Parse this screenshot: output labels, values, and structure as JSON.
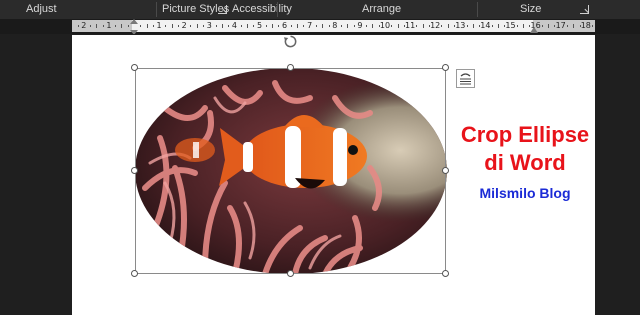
{
  "ribbon": {
    "groups": [
      {
        "label": "Adjust"
      },
      {
        "label": "Picture Styles"
      },
      {
        "label": "Accessibility"
      },
      {
        "label": "Arrange"
      },
      {
        "label": "Size"
      }
    ]
  },
  "ruler": {
    "numbers": [
      "2",
      "1",
      "1",
      "2",
      "3",
      "4",
      "5",
      "6",
      "7",
      "8",
      "9",
      "10",
      "11",
      "12",
      "13",
      "14",
      "15",
      "16",
      "17",
      "18"
    ]
  },
  "document": {
    "title_line1": "Crop Ellipse",
    "title_line2": "di Word",
    "blog_name": "Milsmilo Blog",
    "title_color": "#e8131a",
    "blog_color": "#1b2bd6"
  },
  "picture": {
    "subject": "clownfish in pink sea anemone",
    "shape": "ellipse"
  },
  "icons": {
    "rotate": "rotate-handle-icon",
    "layout": "layout-options-icon"
  }
}
